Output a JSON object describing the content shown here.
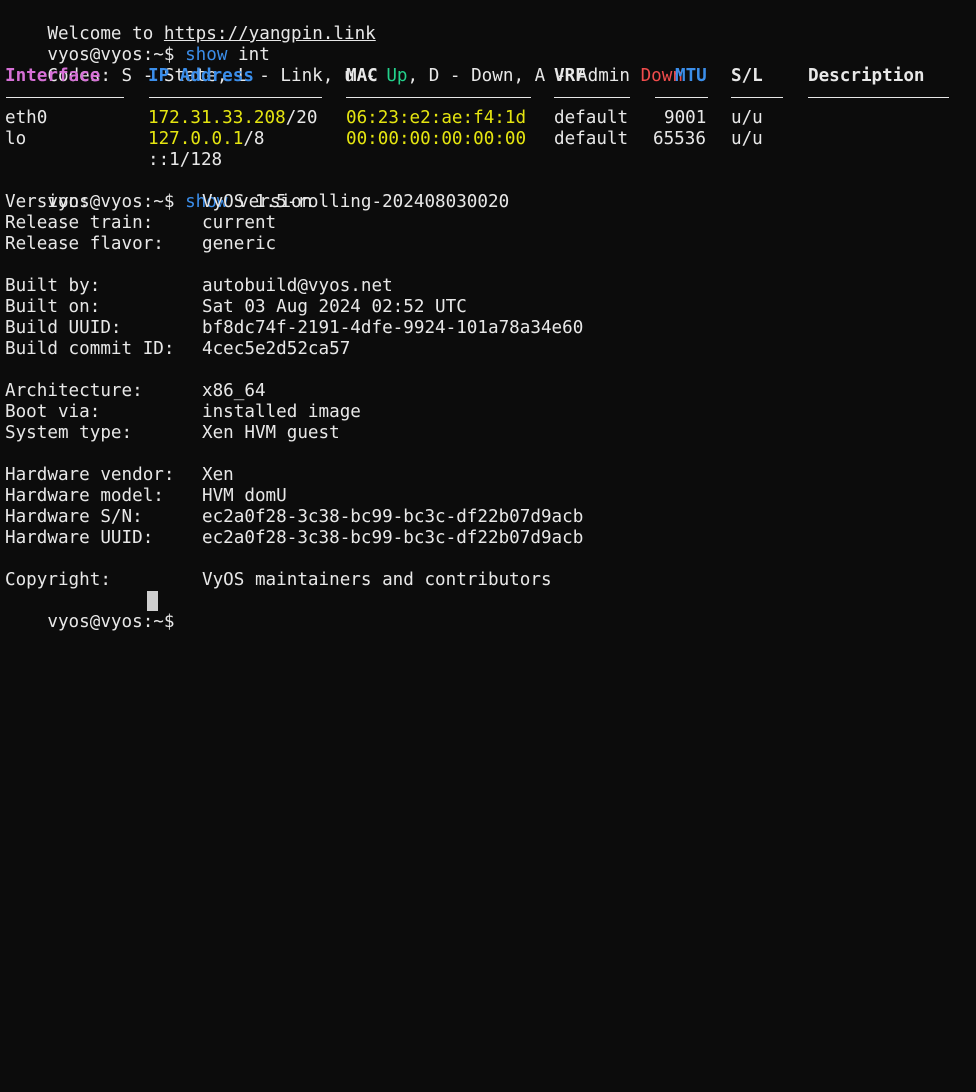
{
  "colors": {
    "background": "#0c0c0c",
    "text": "#e8e8e8",
    "command_blue": "#3b8eea",
    "heading_magenta": "#d670d6",
    "heading_blue": "#3b8eea",
    "up_green": "#23d18b",
    "down_red": "#f14c4c",
    "yellow": "#e5e510"
  },
  "welcome": {
    "text": "Welcome to ",
    "link": "https://yangpin.link"
  },
  "prompt": "vyos@vyos:~$ ",
  "cmd1": {
    "keyword": "show",
    "arg": " int"
  },
  "codes": {
    "prefix": "Codes: S - State, L - Link, u - ",
    "up": "Up",
    "mid": ", D - Down, A - Admin ",
    "down": "Down"
  },
  "interfaces": {
    "headers": {
      "interface": "Interface",
      "ip_address": "IP Address",
      "mac": "MAC",
      "vrf": "VRF",
      "mtu": "MTU",
      "sl": "S/L",
      "description": "Description"
    },
    "rows": [
      {
        "interface": "eth0",
        "ip": "172.31.33.208",
        "mask": "/20",
        "mac": "06:23:e2:ae:f4:1d",
        "vrf": "default",
        "mtu": "9001",
        "sl": "u/u"
      },
      {
        "interface": "lo",
        "ip": "127.0.0.1",
        "mask": "/8",
        "mac": "00:00:00:00:00:00",
        "vrf": "default",
        "mtu": "65536",
        "sl": "u/u"
      }
    ],
    "extra_ip": "::1/128"
  },
  "cmd2": {
    "keyword": "show",
    "arg": " version"
  },
  "version": {
    "version_label": "Version:",
    "version_value": "VyOS 1.5-rolling-202408030020",
    "train_label": "Release train:",
    "train_value": "current",
    "flavor_label": "Release flavor:",
    "flavor_value": "generic",
    "built_by_label": "Built by:",
    "built_by_value": "autobuild@vyos.net",
    "built_on_label": "Built on:",
    "built_on_value": "Sat 03 Aug 2024 02:52 UTC",
    "uuid_label": "Build UUID:",
    "uuid_value": "bf8dc74f-2191-4dfe-9924-101a78a34e60",
    "commit_label": "Build commit ID:",
    "commit_value": "4cec5e2d52ca57",
    "arch_label": "Architecture:",
    "arch_value": "x86_64",
    "boot_label": "Boot via:",
    "boot_value": "installed image",
    "systype_label": "System type:",
    "systype_value": "Xen HVM guest",
    "hw_vendor_label": "Hardware vendor:",
    "hw_vendor_value": "Xen",
    "hw_model_label": "Hardware model:",
    "hw_model_value": "HVM domU",
    "hw_sn_label": "Hardware S/N:",
    "hw_sn_value": "ec2a0f28-3c38-bc99-bc3c-df22b07d9acb",
    "hw_uuid_label": "Hardware UUID:",
    "hw_uuid_value": "ec2a0f28-3c38-bc99-bc3c-df22b07d9acb",
    "copyright_label": "Copyright:",
    "copyright_value": "VyOS maintainers and contributors"
  }
}
